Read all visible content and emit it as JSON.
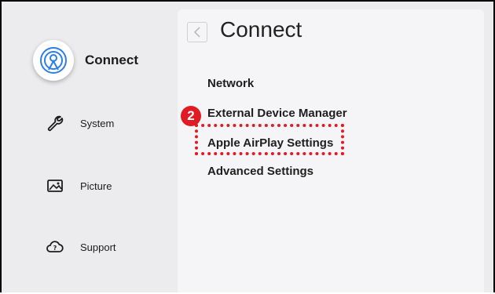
{
  "sidebar": {
    "items": [
      {
        "label": "Connect",
        "icon": "connect-icon",
        "selected": true
      },
      {
        "label": "System",
        "icon": "wrench-icon",
        "selected": false
      },
      {
        "label": "Picture",
        "icon": "picture-icon",
        "selected": false
      },
      {
        "label": "Support",
        "icon": "support-icon",
        "selected": false
      }
    ]
  },
  "panel": {
    "title": "Connect",
    "options": [
      "Network",
      "External Device Manager",
      "Apple AirPlay Settings",
      "Advanced Settings"
    ]
  },
  "annotation": {
    "step_number": "2",
    "highlight_color": "#e01b24"
  },
  "colors": {
    "accent": "#2b7de9",
    "background": "#ececef",
    "panel": "#f5f5f7"
  }
}
